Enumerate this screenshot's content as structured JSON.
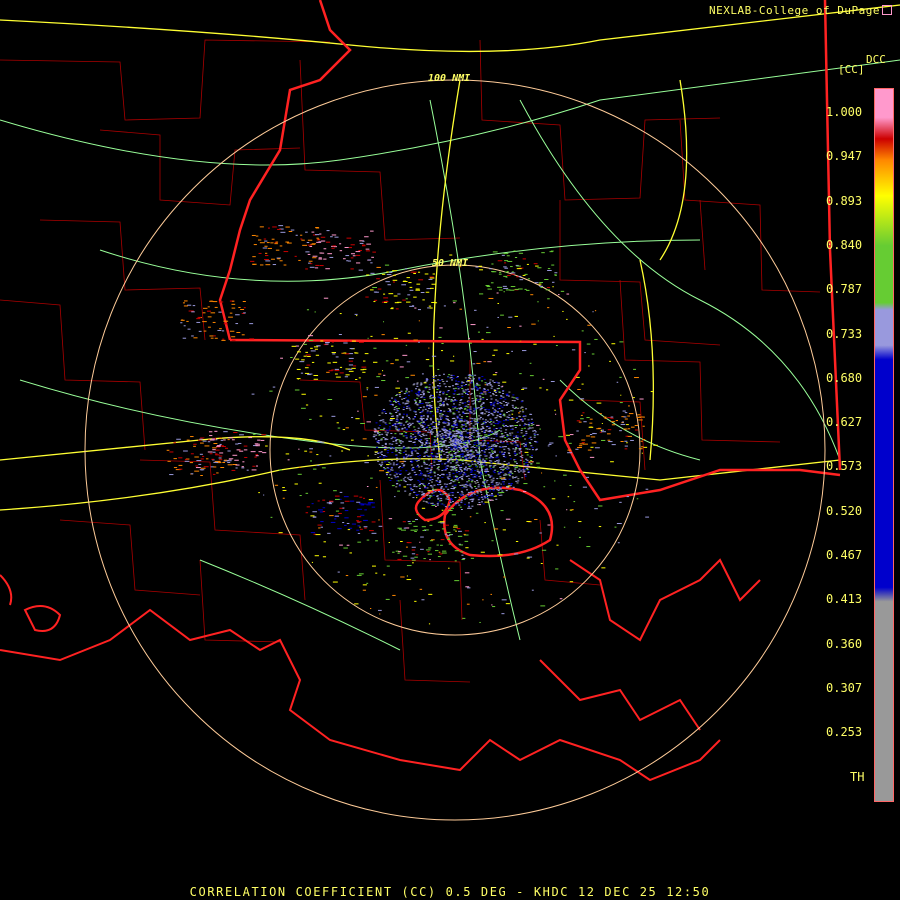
{
  "header": {
    "credit": "NEXLAB-College of DuPage"
  },
  "footer": {
    "title": "CORRELATION COEFFICIENT (CC) 0.5 DEG - KHDC 12 DEC 25 12:50"
  },
  "map": {
    "range_rings": [
      "100 NMI",
      "50 NMI"
    ]
  },
  "legend": {
    "product": "DCC",
    "unit": "[CC]",
    "ticks": [
      "1.000",
      "0.947",
      "0.893",
      "0.840",
      "0.787",
      "0.733",
      "0.680",
      "0.627",
      "0.573",
      "0.520",
      "0.467",
      "0.413",
      "0.360",
      "0.307",
      "0.253",
      "TH"
    ],
    "colors": {
      "pink": "#ff99cc",
      "red": "#cc0000",
      "orange": "#ff8800",
      "yellow": "#ffff00",
      "green": "#66cc33",
      "lavender": "#9999dd",
      "blue": "#0000cc",
      "gray": "#999999",
      "boundary": "#ff2222",
      "highway_yellow": "#ffff33",
      "highway_green": "#99ff99"
    }
  }
}
